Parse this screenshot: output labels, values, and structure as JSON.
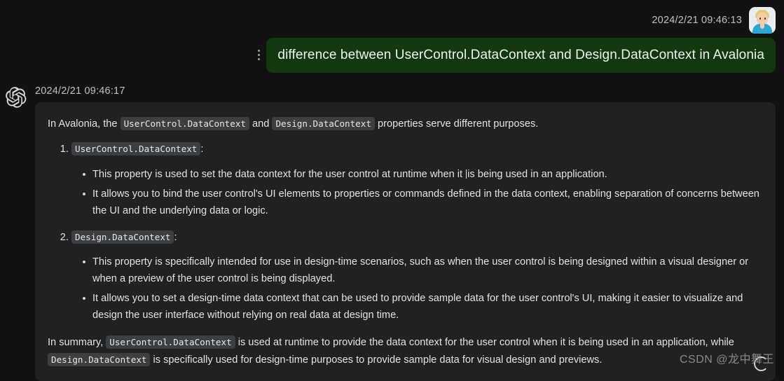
{
  "theme": {
    "page_background": "#121212",
    "assistant_panel_background": "#212121",
    "user_bubble_background": "#133810",
    "inline_code_background": "#3b3f42",
    "text_color": "#e3e3e3",
    "timestamp_color": "#b9c0c8"
  },
  "user_message": {
    "timestamp": "2024/2/21 09:46:13",
    "avatar_icon": "user-avatar-blond-person",
    "menu_icon": "kebab-menu-icon",
    "text": "difference between  UserControl.DataContext and Design.DataContext in Avalonia"
  },
  "assistant_message": {
    "timestamp": "2024/2/21 09:46:17",
    "avatar_icon": "openai-logo-icon",
    "intro": {
      "part1": "In Avalonia, the ",
      "code1": "UserControl.DataContext",
      "part2": " and ",
      "code2": "Design.DataContext",
      "part3": " properties serve different purposes."
    },
    "numbered_items": [
      {
        "number": "1.",
        "code": "UserControl.DataContext",
        "suffix": ":",
        "bullets": [
          {
            "before_caret": "This property is used to set the data context for the user control at runtime when it ",
            "after_caret": "is being used in an application.",
            "has_caret": true
          },
          {
            "text": "It allows you to bind the user control's UI elements to properties or commands defined in the data context, enabling separation of concerns between the UI and the underlying data or logic.",
            "has_caret": false
          }
        ]
      },
      {
        "number": "2.",
        "code": "Design.DataContext",
        "suffix": ":",
        "bullets": [
          {
            "text": "This property is specifically intended for use in design-time scenarios, such as when the user control is being designed within a visual designer or when a preview of the user control is being displayed.",
            "has_caret": false
          },
          {
            "text": "It allows you to set a design-time data context that can be used to provide sample data for the user control's UI, making it easier to visualize and design the user interface without relying on real data at design time.",
            "has_caret": false
          }
        ]
      }
    ],
    "summary": {
      "part1": "In summary, ",
      "code1": "UserControl.DataContext",
      "part2": " is used at runtime to provide the data context for the user control when it is being used in an application, while ",
      "code2": "Design.DataContext",
      "part3": " is specifically used for design-time purposes to provide sample data for visual design and previews."
    },
    "loading_icon": "loading-spinner-icon"
  },
  "watermark": {
    "text": "CSDN @龙中舞王"
  }
}
